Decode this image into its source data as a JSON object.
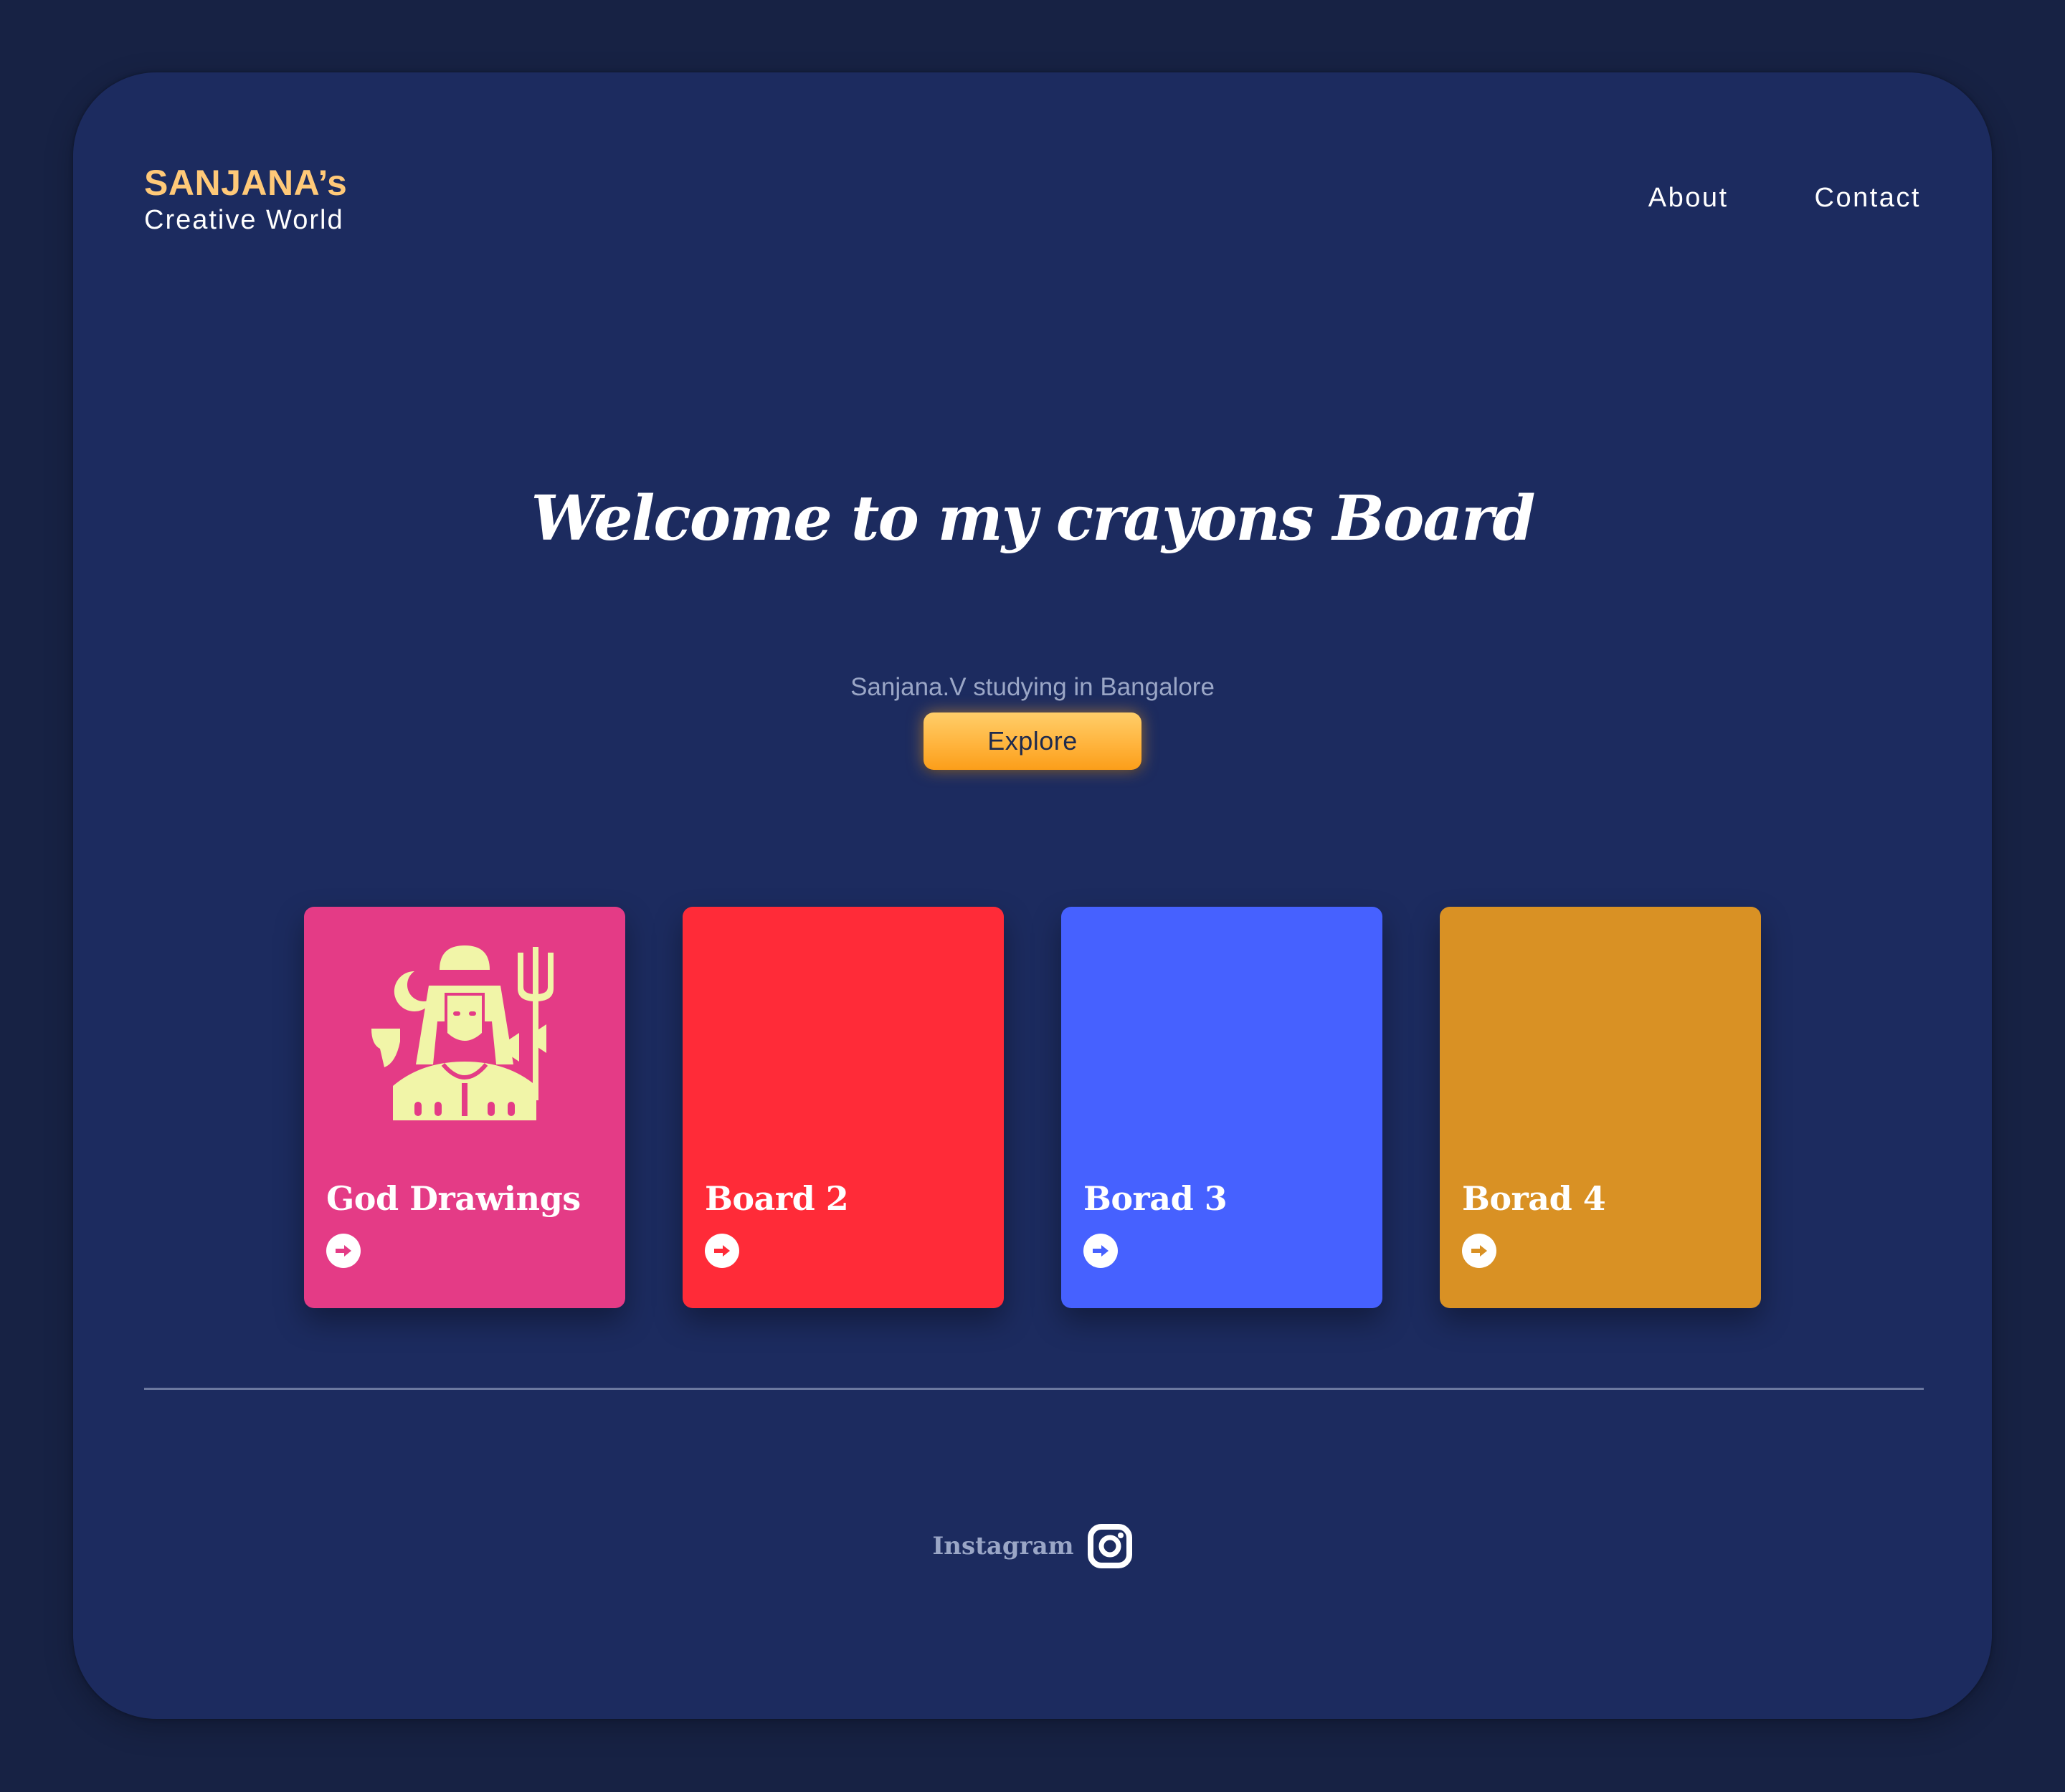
{
  "header": {
    "brand_name": "SANJANA’s",
    "brand_tagline": "Creative World",
    "nav": [
      {
        "label": "About"
      },
      {
        "label": "Contact"
      }
    ]
  },
  "hero": {
    "title": "Welcome to my crayons Board",
    "subtitle": "Sanjana.V studying in Bangalore",
    "cta_label": "Explore"
  },
  "cards": [
    {
      "title": "God Drawings",
      "color": "#e43b86",
      "arrow_color": "#e43b86",
      "icon": "shiva-icon",
      "icon_color": "#f1f5a8"
    },
    {
      "title": "Board 2",
      "color": "#ff2b38",
      "arrow_color": "#ff2b38"
    },
    {
      "title": "Borad 3",
      "color": "#4661ff",
      "arrow_color": "#4661ff"
    },
    {
      "title": "Borad 4",
      "color": "#d99124",
      "arrow_color": "#d99124"
    }
  ],
  "footer": {
    "social_label": "Instagram",
    "social_icon": "instagram-icon"
  },
  "colors": {
    "page_bg": "#172244",
    "frame_bg": "#1c2b5f",
    "brand_accent": "#ffc978",
    "button": "#ffb23a"
  }
}
